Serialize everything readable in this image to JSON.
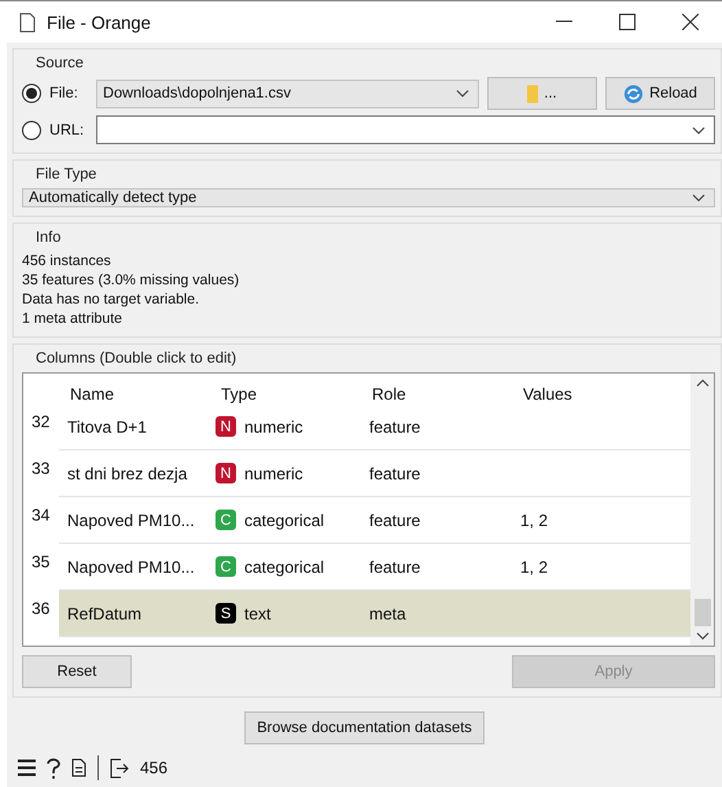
{
  "window": {
    "title": "File - Orange"
  },
  "source": {
    "title": "Source",
    "options": [
      {
        "label": "File:",
        "selected": true,
        "value": "Downloads\\dopolnjena1.csv"
      },
      {
        "label": "URL:",
        "selected": false
      }
    ],
    "browse_button": "...",
    "reload_button": "Reload"
  },
  "file_type": {
    "title": "File Type",
    "value": "Automatically detect type"
  },
  "info": {
    "title": "Info",
    "lines": [
      "456 instances",
      "35 features (3.0% missing values)",
      "Data has no target variable.",
      "1 meta attribute"
    ]
  },
  "columns": {
    "title": "Columns (Double click to edit)",
    "headers": [
      "Name",
      "Type",
      "Role",
      "Values"
    ],
    "rows": [
      {
        "index": "32",
        "name": "Titova D+1",
        "badge": "N",
        "color": "#c0152f",
        "type": "numeric",
        "role": "feature",
        "selected": false
      },
      {
        "index": "33",
        "name": "st dni brez dezja",
        "badge": "N",
        "color": "#c0152f",
        "type": "numeric",
        "role": "feature",
        "selected": false
      },
      {
        "index": "34",
        "name": "Napoved PM10...",
        "badge": "C",
        "color": "#2ea64c",
        "type": "categorical",
        "role": "feature",
        "values": "1, 2",
        "selected": false
      },
      {
        "index": "35",
        "name": "Napoved PM10...",
        "badge": "C",
        "color": "#2ea64c",
        "type": "categorical",
        "role": "feature",
        "values": "1, 2",
        "selected": false
      },
      {
        "index": "36",
        "name": "RefDatum",
        "badge": "S",
        "color": "#000000",
        "type": "text",
        "role": "meta",
        "selected": true
      }
    ]
  },
  "buttons": [
    {
      "label": "Reset",
      "disabled": false
    },
    {
      "label": "Apply",
      "disabled": true
    }
  ],
  "browse_docs": "Browse documentation datasets",
  "status_bar": {
    "output_count": "456"
  }
}
